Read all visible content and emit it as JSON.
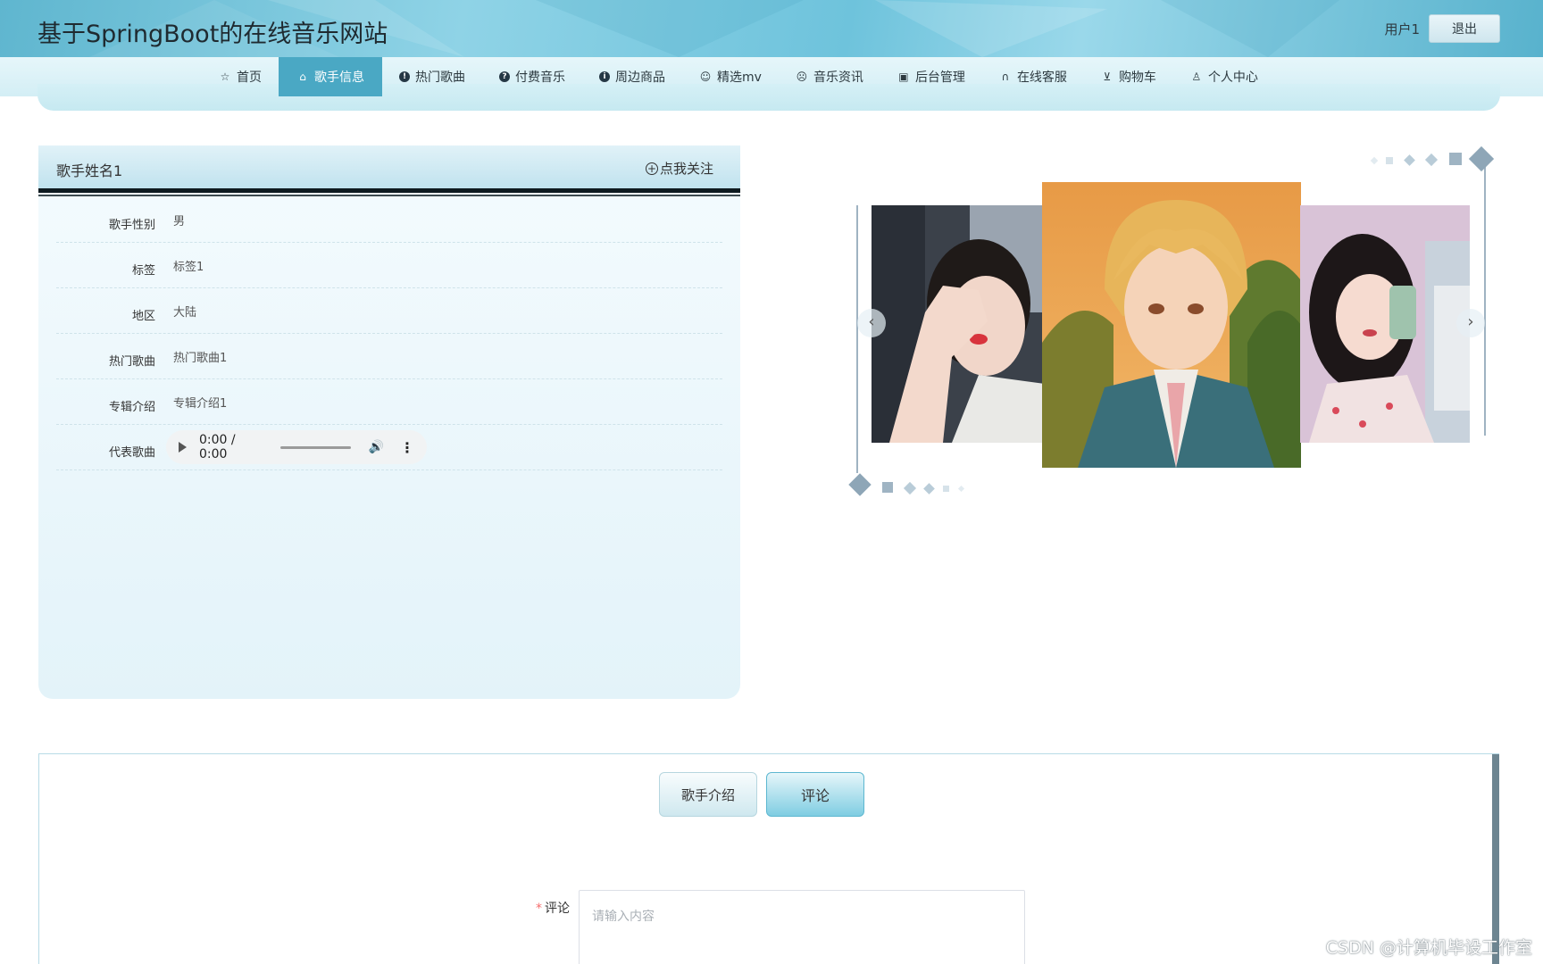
{
  "header": {
    "site_title": "基于SpringBoot的在线音乐网站",
    "user_name": "用户1",
    "logout_label": "退出"
  },
  "nav": {
    "items": [
      {
        "label": "首页",
        "icon": "star-icon",
        "active": false
      },
      {
        "label": "歌手信息",
        "icon": "bag-icon",
        "active": true
      },
      {
        "label": "热门歌曲",
        "icon": "exclamation-icon",
        "active": false
      },
      {
        "label": "付费音乐",
        "icon": "question-icon",
        "active": false
      },
      {
        "label": "周边商品",
        "icon": "info-icon",
        "active": false
      },
      {
        "label": "精选mv",
        "icon": "smile-icon",
        "active": false
      },
      {
        "label": "音乐资讯",
        "icon": "face-icon",
        "active": false
      },
      {
        "label": "后台管理",
        "icon": "box-icon",
        "active": false
      },
      {
        "label": "在线客服",
        "icon": "headset-icon",
        "active": false
      },
      {
        "label": "购物车",
        "icon": "cart-icon",
        "active": false
      },
      {
        "label": "个人中心",
        "icon": "user-icon",
        "active": false
      }
    ]
  },
  "singer": {
    "name": "歌手姓名1",
    "follow_label": "点我关注",
    "fields": [
      {
        "label": "歌手性别",
        "value": "男"
      },
      {
        "label": "标签",
        "value": "标签1"
      },
      {
        "label": "地区",
        "value": "大陆"
      },
      {
        "label": "热门歌曲",
        "value": "热门歌曲1"
      },
      {
        "label": "专辑介绍",
        "value": "专辑介绍1"
      },
      {
        "label": "代表歌曲",
        "value": ""
      }
    ],
    "audio_time": "0:00 / 0:00"
  },
  "carousel": {
    "prev_label": "‹",
    "next_label": "›"
  },
  "tabs": {
    "intro_label": "歌手介绍",
    "comment_label": "评论"
  },
  "comment_form": {
    "required_mark": "*",
    "label": "评论",
    "placeholder": "请输入内容"
  },
  "watermark": "CSDN @计算机毕设工作室",
  "colors": {
    "accent": "#4aa8c4",
    "header": "#6ec3dc",
    "required": "#f56c6c"
  }
}
